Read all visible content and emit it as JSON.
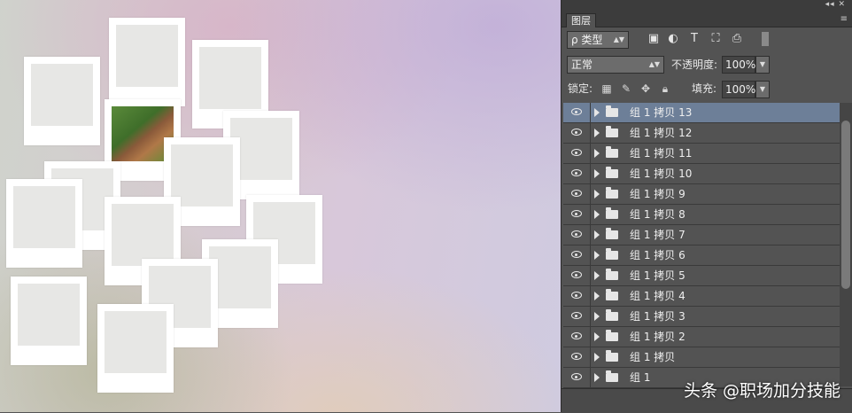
{
  "panel": {
    "tab_label": "图层",
    "filter": {
      "label": "ρ 类型"
    },
    "blend_mode": "正常",
    "opacity_label": "不透明度:",
    "opacity_value": "100%",
    "lock_label": "锁定:",
    "fill_label": "填充:",
    "fill_value": "100%"
  },
  "layers": [
    {
      "name": "组 1 拷贝 13",
      "active": true
    },
    {
      "name": "组 1 拷贝 12"
    },
    {
      "name": "组 1 拷贝 11"
    },
    {
      "name": "组 1 拷贝 10"
    },
    {
      "name": "组 1 拷贝 9"
    },
    {
      "name": "组 1 拷贝 8"
    },
    {
      "name": "组 1 拷贝 7"
    },
    {
      "name": "组 1 拷贝 6"
    },
    {
      "name": "组 1 拷贝 5"
    },
    {
      "name": "组 1 拷贝 4"
    },
    {
      "name": "组 1 拷贝 3"
    },
    {
      "name": "组 1 拷贝 2"
    },
    {
      "name": "组 1 拷贝"
    },
    {
      "name": "组 1"
    }
  ],
  "watermark": "头条 @职场加分技能",
  "colors": {
    "panel_bg": "#535353",
    "active_layer": "#6d7f98"
  }
}
